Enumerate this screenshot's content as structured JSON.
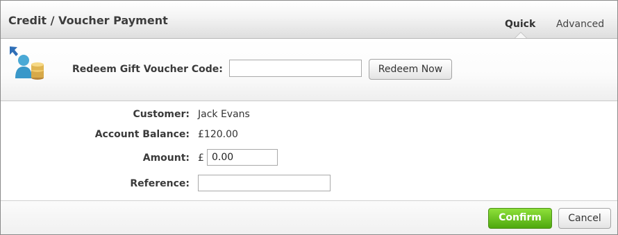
{
  "dialog": {
    "title": "Credit / Voucher Payment",
    "tabs": [
      {
        "label": "Quick",
        "active": true
      },
      {
        "label": "Advanced",
        "active": false
      }
    ]
  },
  "voucher": {
    "icon": "customer-coins-icon",
    "label": "Redeem Gift Voucher Code:",
    "code_value": "",
    "redeem_label": "Redeem Now"
  },
  "form": {
    "customer_label": "Customer:",
    "customer_value": "Jack Evans",
    "balance_label": "Account Balance:",
    "balance_value": "£120.00",
    "amount_label": "Amount:",
    "currency_symbol": "£",
    "amount_value": "0.00",
    "reference_label": "Reference:",
    "reference_value": ""
  },
  "footer": {
    "confirm_label": "Confirm",
    "cancel_label": "Cancel"
  },
  "colors": {
    "confirm_green": "#5cb81a",
    "header_text": "#3d3d3d"
  }
}
